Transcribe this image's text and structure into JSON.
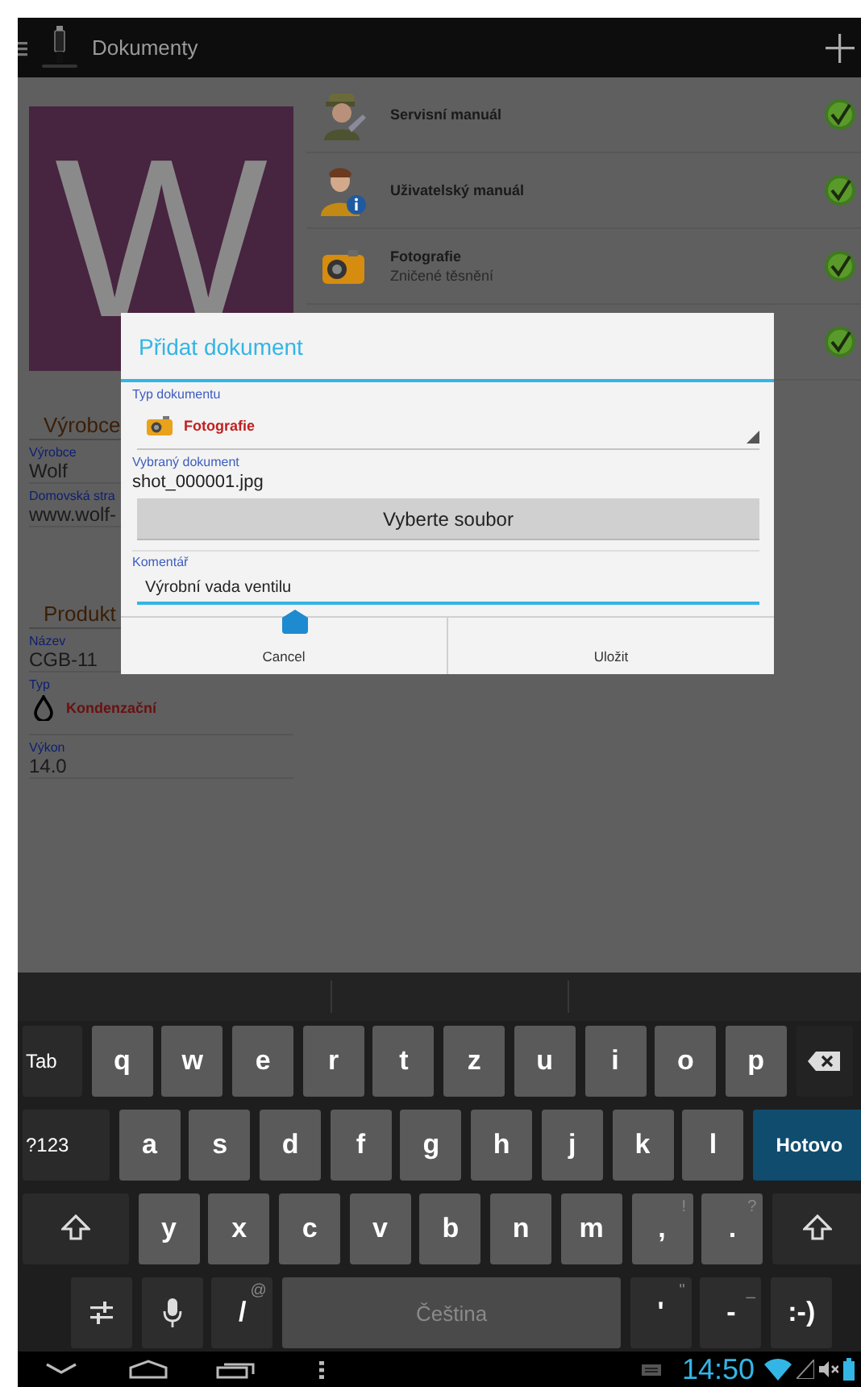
{
  "action_bar": {
    "title": "Dokumenty"
  },
  "logo": {
    "letter": "W"
  },
  "manufacturer": {
    "heading": "Výrobce",
    "fields": [
      {
        "label": "Výrobce",
        "value": "Wolf"
      },
      {
        "label": "Domovská stra",
        "value": "www.wolf-"
      }
    ]
  },
  "product": {
    "heading": "Produkt",
    "fields": [
      {
        "kind": "text",
        "label": "Název",
        "value": "CGB-11"
      },
      {
        "kind": "type",
        "label": "Typ",
        "value": "Kondenzační"
      },
      {
        "kind": "text",
        "label": "Výkon",
        "value": "14.0"
      }
    ]
  },
  "documents": [
    {
      "kind": "worker",
      "title": "Servisní manuál",
      "checked": true
    },
    {
      "kind": "user",
      "title": "Uživatelský manuál",
      "checked": true
    },
    {
      "kind": "photo",
      "title": "Fotografie",
      "subtitle": "Zničené těsnění",
      "checked": true
    },
    {
      "checked": true
    }
  ],
  "dialog": {
    "title": "Přidat dokument",
    "type_label": "Typ dokumentu",
    "type_value": "Fotografie",
    "file_label": "Vybraný dokument",
    "file_name": "shot_000001.jpg",
    "choose_button": "Vyberte soubor",
    "comment_label": "Komentář",
    "comment_value": "Výrobní vada ventilu",
    "buttons": [
      "Cancel",
      "Uložit"
    ]
  },
  "keyboard": {
    "rows": [
      {
        "keys": [
          {
            "kind": "function",
            "label": "Tab"
          },
          {
            "kind": "letter",
            "label": "q"
          },
          {
            "kind": "letter",
            "label": "w"
          },
          {
            "kind": "letter",
            "label": "e"
          },
          {
            "kind": "letter",
            "label": "r"
          },
          {
            "kind": "letter",
            "label": "t"
          },
          {
            "kind": "letter",
            "label": "z"
          },
          {
            "kind": "letter",
            "label": "u"
          },
          {
            "kind": "letter",
            "label": "i"
          },
          {
            "kind": "letter",
            "label": "o"
          },
          {
            "kind": "letter",
            "label": "p"
          },
          {
            "kind": "backspace"
          }
        ]
      },
      {
        "keys": [
          {
            "kind": "function",
            "label": "?123"
          },
          {
            "kind": "letter",
            "label": "a"
          },
          {
            "kind": "letter",
            "label": "s"
          },
          {
            "kind": "letter",
            "label": "d"
          },
          {
            "kind": "letter",
            "label": "f"
          },
          {
            "kind": "letter",
            "label": "g"
          },
          {
            "kind": "letter",
            "label": "h"
          },
          {
            "kind": "letter",
            "label": "j"
          },
          {
            "kind": "letter",
            "label": "k"
          },
          {
            "kind": "letter",
            "label": "l"
          },
          {
            "kind": "action",
            "label": "Hotovo"
          }
        ]
      },
      {
        "keys": [
          {
            "kind": "shift"
          },
          {
            "kind": "letter",
            "label": "y"
          },
          {
            "kind": "letter",
            "label": "x"
          },
          {
            "kind": "letter",
            "label": "c"
          },
          {
            "kind": "letter",
            "label": "v"
          },
          {
            "kind": "letter",
            "label": "b"
          },
          {
            "kind": "letter",
            "label": "n"
          },
          {
            "kind": "letter",
            "label": "m"
          },
          {
            "kind": "letter",
            "label": ",",
            "hint": "!"
          },
          {
            "kind": "letter",
            "label": ".",
            "hint": "?"
          },
          {
            "kind": "shift"
          }
        ]
      },
      {
        "keys": [
          {
            "kind": "settings"
          },
          {
            "kind": "mic"
          },
          {
            "kind": "dark",
            "label": "/",
            "hint": "@"
          },
          {
            "kind": "space",
            "label": "Čeština"
          },
          {
            "kind": "dark",
            "label": "'",
            "hint": "\""
          },
          {
            "kind": "dark",
            "label": "-",
            "hint": "_"
          },
          {
            "kind": "dark",
            "label": ":-)"
          }
        ]
      }
    ]
  },
  "status_bar": {
    "time": "14:50"
  }
}
